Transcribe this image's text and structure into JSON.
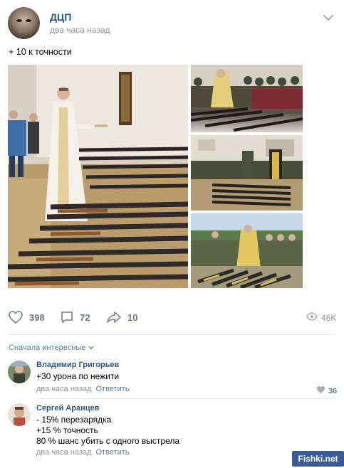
{
  "post": {
    "group_name": "ДЦП",
    "time": "два часа назад",
    "text": "+ 10 к точности"
  },
  "actions": {
    "likes": "398",
    "comments": "72",
    "shares": "10",
    "views": "46K"
  },
  "comments_sort": "Сначала интересные",
  "comments": [
    {
      "author": "Владимир Григорьев",
      "lines": [
        "+30 урона по нежити"
      ],
      "time": "два часа назад",
      "reply": "Ответить",
      "likes": "36"
    },
    {
      "author": "Сергей Аранцев",
      "lines": [
        "- 15% перезарядка",
        "+15 % точность",
        "80 % шанс убить с одного выстрела"
      ],
      "time": "два часа назад",
      "reply": "Ответить"
    }
  ],
  "watermark": "Fishki.net",
  "colors": {
    "link": "#2a5885",
    "muted": "#939393",
    "action": "#6f7985",
    "accent": "#5e7fa4"
  }
}
